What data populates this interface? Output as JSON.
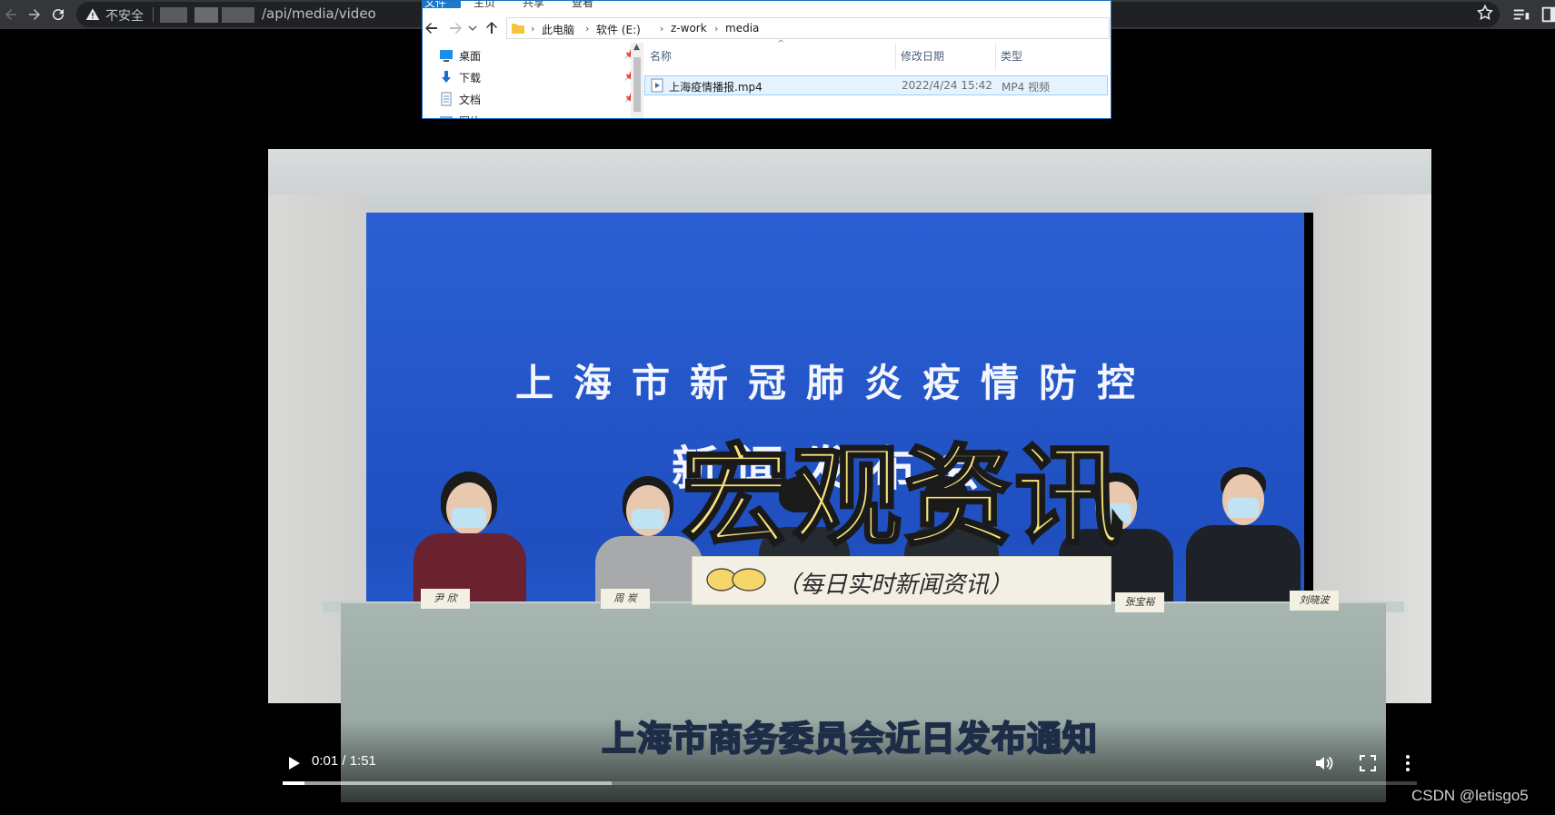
{
  "browser": {
    "security_label": "不安全",
    "url_path": "/api/media/video"
  },
  "explorer": {
    "ribbon_tabs": [
      "文件",
      "主页",
      "共享",
      "查看"
    ],
    "breadcrumbs": [
      "此电脑",
      "软件 (E:)",
      "z-work",
      "media"
    ],
    "nav_items": [
      {
        "label": "桌面",
        "icon": "desktop-icon"
      },
      {
        "label": "下载",
        "icon": "download-icon"
      },
      {
        "label": "文档",
        "icon": "document-icon"
      },
      {
        "label": "图片",
        "icon": "picture-icon"
      }
    ],
    "columns": {
      "name": "名称",
      "modified": "修改日期",
      "type": "类型"
    },
    "files": [
      {
        "name": "上海疫情播报.mp4",
        "modified": "2022/4/24 15:42",
        "type": "MP4 视频"
      }
    ]
  },
  "video": {
    "backdrop_line1": "上海市新冠肺炎疫情防控",
    "backdrop_line2": "新闻发布会",
    "overlay_title": "宏观资讯",
    "caption": "（每日实时新闻资讯）",
    "subtitle": "上海市商务委员会近日发布通知",
    "nameplates": [
      "尹 欣",
      "周 炭",
      "张宝裕",
      "刘晓波"
    ],
    "time_display": "0:01 / 1:51",
    "played_fraction": 0.003,
    "buffered_fraction": 0.29
  },
  "watermark": "CSDN @letisgo5",
  "colors": {
    "toolbar": "#35363a",
    "backdrop_blue": "#2458c8",
    "title_yellow": "#f6e37a",
    "explorer_accent": "#1979ca"
  }
}
